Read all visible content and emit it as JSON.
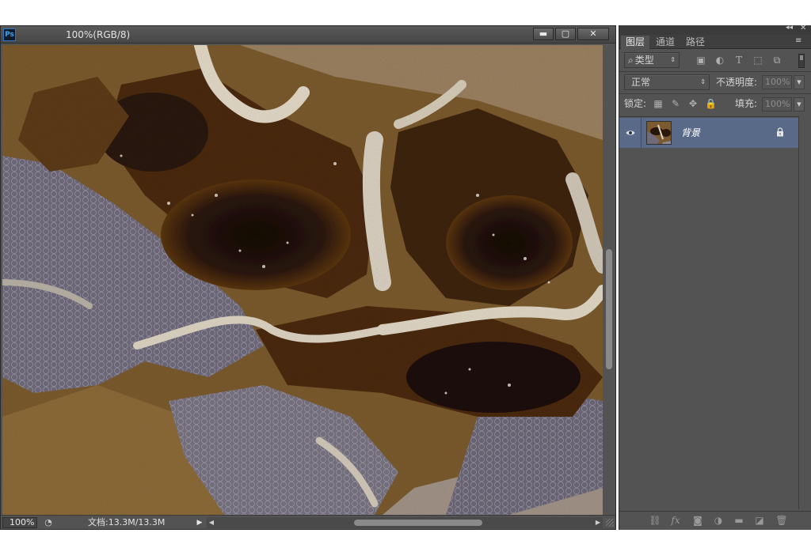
{
  "document": {
    "title": "100%(RGB/8)",
    "app_logo_text": "Ps",
    "window_buttons": {
      "minimize": "▬",
      "maximize": "▢",
      "close": "✕"
    },
    "canvas_image": "brown-gray-marble-texture"
  },
  "status_bar": {
    "zoom": "100%",
    "status_icon": "◔",
    "doc_size": "文档:13.3M/13.3M",
    "menu_arrow": "▶",
    "scroll_left": "◀",
    "scroll_right": "▶"
  },
  "layers_panel": {
    "collapse_label": "◂◂",
    "close_label": "✕",
    "menu_icon": "≡",
    "tabs": [
      {
        "label": "图层",
        "active": true
      },
      {
        "label": "通道",
        "active": false
      },
      {
        "label": "路径",
        "active": false
      }
    ],
    "filter": {
      "icon": "⌕",
      "kind": "类型",
      "arrow": "⇕"
    },
    "filter_icons": {
      "image": "▣",
      "adjustment": "◐",
      "text": "T",
      "shape": "⬚",
      "smart_object": "⧉"
    },
    "blend_mode": "正常",
    "blend_arrow": "⇕",
    "opacity_label": "不透明度:",
    "opacity_value": "100%",
    "lock_label": "锁定:",
    "lock_icons": {
      "pixels": "▦",
      "paint": "✎",
      "move": "✥",
      "all": "🔒"
    },
    "fill_label": "填充:",
    "fill_value": "100%",
    "spin_arrow": "▼",
    "layers": [
      {
        "name": "背景",
        "visible": true,
        "locked": true,
        "selected": true
      }
    ],
    "footer_icons": {
      "link": "⛓",
      "fx": "fx",
      "mask": "◙",
      "adjustment": "◑",
      "group": "▬",
      "new_layer": "◪",
      "delete": "🗑"
    }
  },
  "colors": {
    "panel_bg": "#535353",
    "selected_layer": "#586a88",
    "title_bar": "#4f4f4f"
  }
}
